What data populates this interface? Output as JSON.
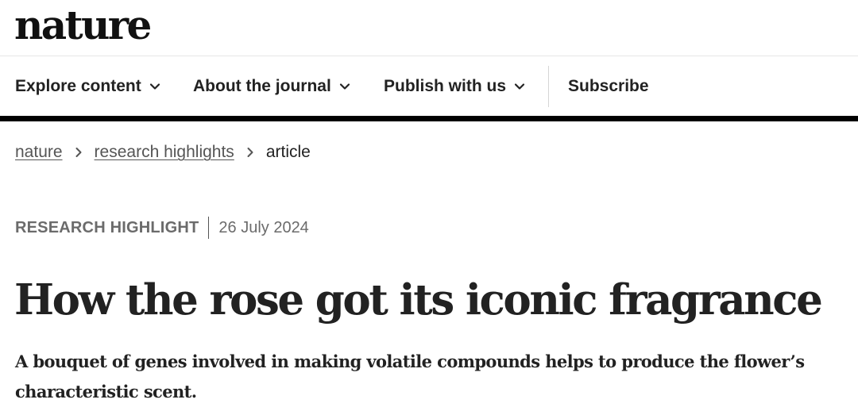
{
  "site": {
    "logo_text": "nature"
  },
  "nav": {
    "items": [
      {
        "label": "Explore content",
        "has_dropdown": true,
        "icon": "chevron-down-icon"
      },
      {
        "label": "About the journal",
        "has_dropdown": true,
        "icon": "chevron-down-icon"
      },
      {
        "label": "Publish with us",
        "has_dropdown": true,
        "icon": "chevron-down-icon"
      }
    ],
    "subscribe_label": "Subscribe"
  },
  "breadcrumb": {
    "items": [
      {
        "label": "nature",
        "link": true
      },
      {
        "label": "research highlights",
        "link": true
      },
      {
        "label": "article",
        "link": false
      }
    ],
    "separator_icon": "chevron-right-icon"
  },
  "article": {
    "type": "RESEARCH HIGHLIGHT",
    "date": "26 July 2024",
    "title": "How the rose got its iconic fragrance",
    "standfirst": "A bouquet of genes involved in making volatile compounds helps to produce the flower’s characteristic scent."
  },
  "colors": {
    "text": "#222222",
    "muted": "#6b6b6b",
    "rule": "#000000",
    "divider": "#d5d5d5"
  }
}
